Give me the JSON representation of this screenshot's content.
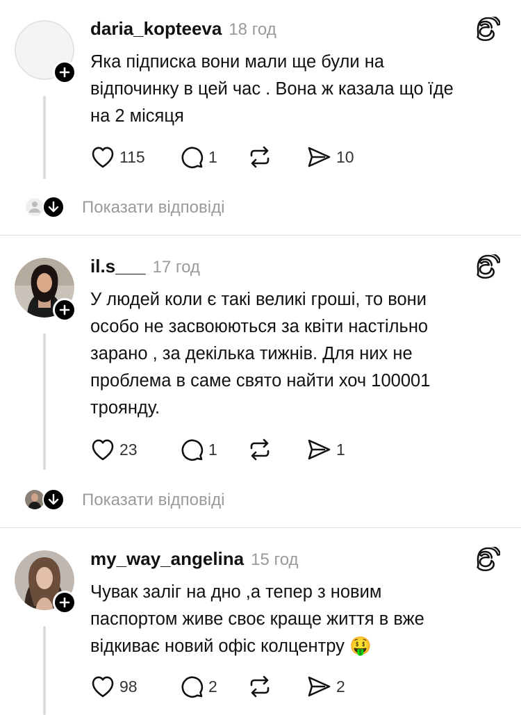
{
  "posts": [
    {
      "username": "daria_kopteeva",
      "time": "18 год",
      "text": "Яка підписка вони мали ще були на\nвідпочинку в цей час . Вона ж казала що їде\nна 2 місяця",
      "likes": "115",
      "comments": "1",
      "shares": "10",
      "show_replies": "Показати відповіді",
      "avatar": "default-avatar"
    },
    {
      "username": "il.s___",
      "time": "17 год",
      "text": "У людей коли є такі великі гроші, то вони\nособо не засвоюються за квіти настільно\nзарано , за декілька тижнів. Для них не\nпроблема в саме свято найти хоч 100001\nтроянду.",
      "likes": "23",
      "comments": "1",
      "shares": "1",
      "show_replies": "Показати відповіді",
      "avatar": "photo-dark-hair"
    },
    {
      "username": "my_way_angelina",
      "time": "15 год",
      "text": "Чувак заліг на дно ,а тепер з новим\nпаспортом живе своє краще життя  в вже\nвідкиває новий офіс колцентру 🤑",
      "likes": "98",
      "comments": "2",
      "shares": "2",
      "avatar": "photo-light-hair"
    }
  ],
  "icons": {
    "like": "heart-icon",
    "comment": "comment-icon",
    "repost": "repost-icon",
    "share": "share-icon",
    "brand": "threads-icon",
    "follow": "plus-icon",
    "expand": "arrow-down-icon"
  },
  "colors": {
    "text": "#111111",
    "muted": "#9a9a9a",
    "divider": "#dedede",
    "thread_line": "#dcdcdc"
  }
}
